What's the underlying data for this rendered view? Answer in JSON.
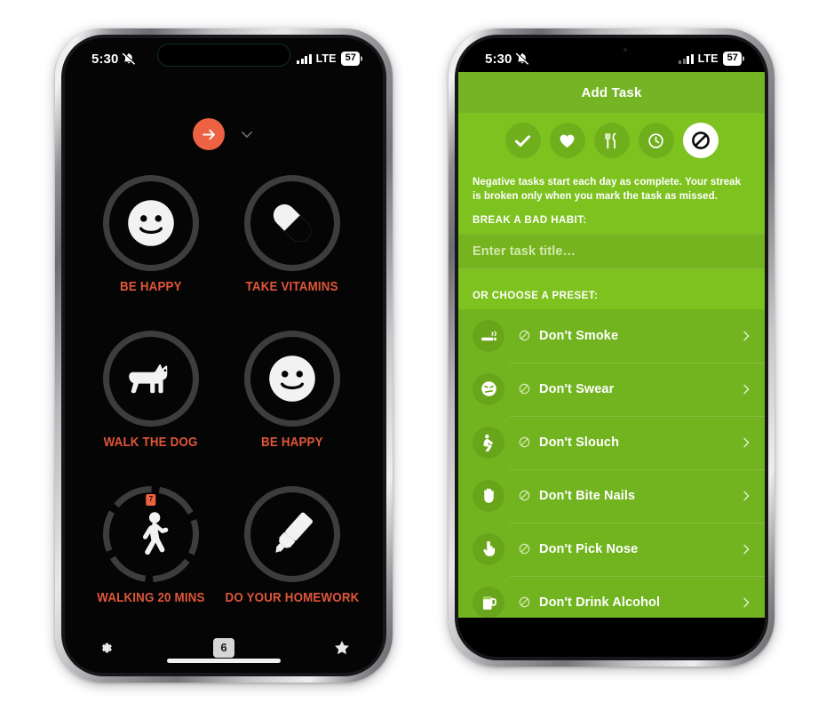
{
  "status_bar": {
    "time": "5:30",
    "mute_icon": "bell-slash-icon",
    "network": "LTE",
    "battery": "57"
  },
  "colors": {
    "accent_orange": "#ec6243",
    "label_orange": "#e0563a",
    "header_green": "#74b425",
    "body_green": "#7ec21f",
    "field_green": "#75b41f",
    "list_green": "#72b41f",
    "avatar_green": "#68a51b",
    "screen_black": "#050505",
    "ring_grey": "#3d3d3d"
  },
  "left_screen": {
    "name": "task-grid-screen",
    "add_button_icon": "arrow-right-icon",
    "collapse_icon": "chevron-down-icon",
    "tasks": [
      {
        "label": "BE HAPPY",
        "icon": "smiley-face-icon",
        "ring": "plain",
        "badge": null
      },
      {
        "label": "TAKE VITAMINS",
        "icon": "pill-icon",
        "ring": "plain",
        "badge": null
      },
      {
        "label": "WALK THE DOG",
        "icon": "dog-icon",
        "ring": "plain",
        "badge": null
      },
      {
        "label": "BE HAPPY",
        "icon": "smiley-face-icon",
        "ring": "plain",
        "badge": null
      },
      {
        "label": "WALKING 20 MINS",
        "icon": "walking-icon",
        "ring": "segmented",
        "badge": "7"
      },
      {
        "label": "DO YOUR HOMEWORK",
        "icon": "highlighter-icon",
        "ring": "plain",
        "badge": null
      }
    ],
    "tab_bar": {
      "settings_icon": "gear-icon",
      "count": "6",
      "favorites_icon": "star-icon"
    }
  },
  "right_screen": {
    "name": "add-task-screen",
    "title": "Add Task",
    "type_tabs": [
      {
        "icon": "check-icon",
        "name": "tab-good-habit",
        "active": false
      },
      {
        "icon": "heart-icon",
        "name": "tab-health",
        "active": false
      },
      {
        "icon": "cutlery-icon",
        "name": "tab-food",
        "active": false
      },
      {
        "icon": "clock-icon",
        "name": "tab-timed",
        "active": false
      },
      {
        "icon": "prohibit-icon",
        "name": "tab-bad-habit",
        "active": true
      }
    ],
    "description": "Negative tasks start each day as complete. Your streak is broken only when you mark the task as missed.",
    "field_label": "BREAK A BAD HABIT:",
    "input_placeholder": "Enter task title…",
    "input_value": "",
    "preset_label": "OR CHOOSE A PRESET:",
    "presets": [
      {
        "label": "Don't Smoke",
        "icon": "cigarette-icon",
        "prefix_icon": "prohibit-icon",
        "chevron": "chevron-right-icon"
      },
      {
        "label": "Don't Swear",
        "icon": "swearing-face-icon",
        "prefix_icon": "prohibit-icon",
        "chevron": "chevron-right-icon"
      },
      {
        "label": "Don't Slouch",
        "icon": "slouching-icon",
        "prefix_icon": "prohibit-icon",
        "chevron": "chevron-right-icon"
      },
      {
        "label": "Don't Bite Nails",
        "icon": "hand-icon",
        "prefix_icon": "prohibit-icon",
        "chevron": "chevron-right-icon"
      },
      {
        "label": "Don't Pick Nose",
        "icon": "pointing-hand-icon",
        "prefix_icon": "prohibit-icon",
        "chevron": "chevron-right-icon"
      },
      {
        "label": "Don't Drink Alcohol",
        "icon": "beer-mug-icon",
        "prefix_icon": "prohibit-icon",
        "chevron": "chevron-right-icon"
      }
    ]
  }
}
